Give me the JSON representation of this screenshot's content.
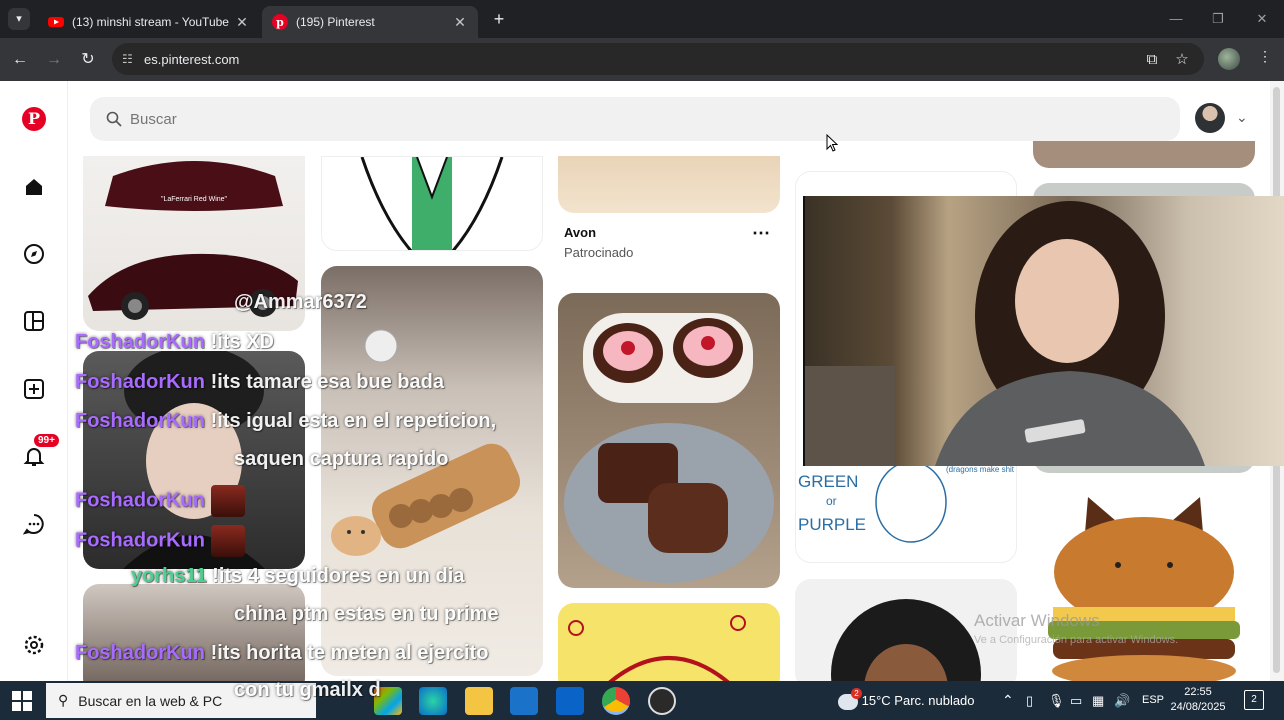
{
  "browser": {
    "tabs": [
      {
        "title": "(13) minshi stream - YouTube",
        "favicon": "youtube-icon"
      },
      {
        "title": "(195) Pinterest",
        "favicon": "pinterest-icon",
        "active": true
      }
    ],
    "url": "es.pinterest.com"
  },
  "pinterest": {
    "search_placeholder": "Buscar",
    "notifications_badge": "99+",
    "nav_icons": [
      "pinterest-logo",
      "home-icon",
      "explore-icon",
      "boards-icon",
      "create-icon",
      "bell-icon",
      "messages-icon",
      "settings-icon"
    ],
    "pins": [
      {
        "label": "\"LaFerrari Red Wine\""
      },
      {
        "title": "Avon",
        "subtitle": "Patrocinado",
        "more": "⋯"
      },
      {
        "sketch_text": [
          "GREEN",
          "or",
          "PURPLE"
        ],
        "sketch_note": "(dragons make shit look cool)"
      }
    ]
  },
  "stream_chat": [
    {
      "user": "",
      "message": "@Ammar6372"
    },
    {
      "user": "FoshadorKun",
      "message": "!its XD"
    },
    {
      "user": "FoshadorKun",
      "message": "!its tamare esa bue bada"
    },
    {
      "user": "FoshadorKun",
      "message": "!its igual esta en el repeticion,"
    },
    {
      "user": "",
      "message": "saquen captura rapido"
    },
    {
      "user": "FoshadorKun",
      "message": ""
    },
    {
      "user": "FoshadorKun",
      "message": ""
    },
    {
      "user": "yorhs11",
      "message": "!its 4 seguidores en un dia"
    },
    {
      "user": "",
      "message": "china ptm estas en tu prime"
    },
    {
      "user": "FoshadorKun",
      "message": "!its horita te meten al ejercito"
    },
    {
      "user": "",
      "message": "con tu gmailx d"
    }
  ],
  "watermark": {
    "line1": "Activar Windows",
    "line2": "Ve a Configuración para activar Windows."
  },
  "taskbar": {
    "search_placeholder": "Buscar en la web & PC",
    "weather_temp": "15°C",
    "weather_desc": "Parc. nublado",
    "language": "ESP",
    "time": "22:55",
    "date": "24/08/2025",
    "weather_badge": "2",
    "notification_badge": "2"
  },
  "colors": {
    "pinterest_red": "#e60023",
    "chat_user": "#a96bff",
    "chat_user_alt": "#4dcf8f"
  }
}
